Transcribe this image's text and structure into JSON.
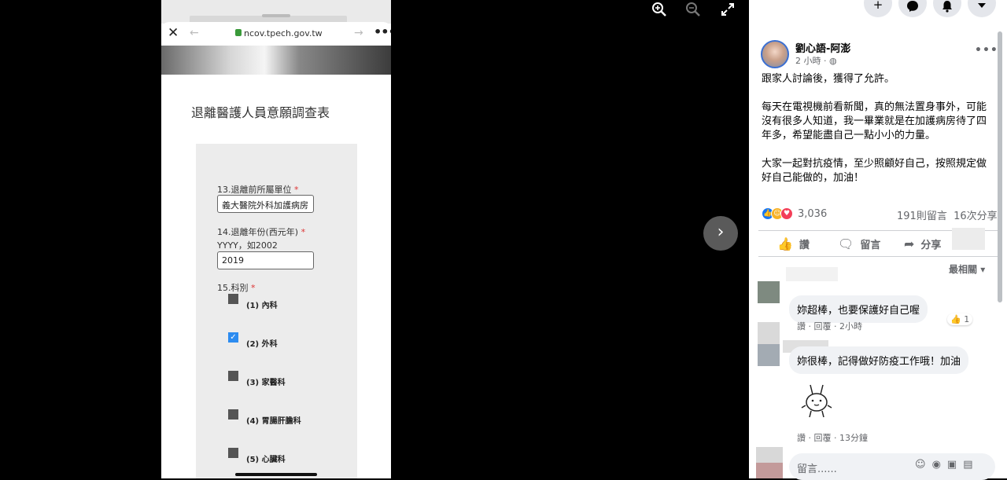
{
  "viewer": {
    "zoom_in_icon": "zoom-in-icon",
    "zoom_out_icon": "zoom-out-icon",
    "fullscreen_icon": "fullscreen-icon",
    "next_label": "›"
  },
  "phone": {
    "url": "ncov.tpech.gov.tw",
    "close_label": "✕",
    "back_label": "←",
    "forward_label": "→",
    "menu_label": "•••",
    "form_title": "退離醫護人員意願調查表",
    "q13_label": "13.退離前所屬單位",
    "q13_value": "義大醫院外科加護病房",
    "q14_label": "14.退離年份(西元年)",
    "q14_hint": "YYYY，如2002",
    "q14_value": "2019",
    "q15_label": "15.科別",
    "required_mark": "*",
    "options": [
      {
        "label": "(1) 內科",
        "checked": false
      },
      {
        "label": "(2) 外科",
        "checked": true
      },
      {
        "label": "(3) 家醫科",
        "checked": false
      },
      {
        "label": "(4) 胃腸肝膽科",
        "checked": false
      },
      {
        "label": "(5) 心臟科",
        "checked": false
      }
    ]
  },
  "facebook": {
    "top_icons": [
      "+",
      "messenger-icon",
      "bell-icon",
      "chevron-down-icon"
    ],
    "author": "劉心語-阿澎",
    "time": "2 小時 · ",
    "globe": "◍",
    "more": "•••",
    "paragraphs": [
      "跟家人討論後，獲得了允許。",
      "每天在電視機前看新聞，真的無法置身事外，可能沒有很多人知道，我一畢業就是在加護病房待了四年多，希望能盡自己一點小小的力量。",
      "大家一起對抗疫情，至少照顧好自己，按照規定做好自己能做的，加油！"
    ],
    "reaction_count": "3,036",
    "comment_count": "191則留言",
    "share_count": "16次分享",
    "action_like": "讚",
    "action_comment": "留言",
    "action_share": "分享",
    "sort_label": "最相關",
    "comments": [
      {
        "text": "妳超棒，也要保護好自己喔",
        "meta": "讚 · 回覆 · 2小時",
        "likes": "1"
      },
      {
        "text": "妳很棒，記得做好防疫工作哦！加油",
        "meta": "讚 · 回覆 · 13分鐘"
      }
    ],
    "comment_placeholder": "留言......"
  },
  "colors": {
    "fb_blue": "#1877f2",
    "secondary_text": "#65676b",
    "bubble_bg": "#f0f2f5"
  }
}
